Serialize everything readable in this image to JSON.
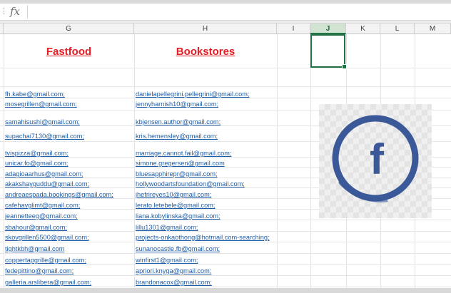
{
  "formula_bar": {
    "fx_label": "fx",
    "value": ""
  },
  "columns": [
    "G",
    "H",
    "I",
    "J",
    "K",
    "L",
    "M"
  ],
  "selected_column": "J",
  "headers": {
    "fastfood": "Fastfood",
    "bookstores": "Bookstores"
  },
  "fastfood_emails": [
    "fh.kabe@gmail.com;",
    "mosegrillen@gmail.com;",
    "samahisushi@gmail.com;",
    "supachai7130@gmail.com;",
    "tvispizza@gmail.com;",
    "unicar.fo@gmail.com;",
    "adagioaarhus@gmail.com;",
    "akakshayguddu@gmail.com;",
    "andreaespada.bookings@gmail.com;",
    "cafehavglimt@gmail.com;",
    "jeannetteeg@gmail.com;",
    "sbahour@gmail.com;",
    "skovgrillen5500@gmail.com;",
    "tightkbh@gmail.com",
    "coppertapgrille@gmail.com;",
    "fedepittino@gmail.com;",
    "galleria.arslibera@gmail.com;"
  ],
  "bookstore_emails": [
    "danielapellegrini.pellegrini@gmail.com;",
    "jennyharnish10@gmail.com;",
    "kbjensen.author@gmail.com;",
    "kris.hemensley@gmail.com;",
    "marriage.cannot.fail@gmail.com;",
    "simone.gregersen@gmail.com",
    "bluesapphirepr@gmail.com;",
    "hollywoodartsfoundation@gmail.com;",
    "jhefrireyes10@gmail.com;",
    "lerato.letebele@gmail.com;",
    "liana.kobylinska@gmail.com;",
    "lillu1301@gmail.com;",
    "projects-onkaothong@hotmail.com-searching;",
    "sunanocastle.fb@gmail.com;",
    "winfirst1@gmail.com;",
    "apriori.knyga@gmail.com;",
    "brandonacox@gmail.com;"
  ],
  "logo": {
    "letter": "f",
    "ring_color": "#3b5998"
  }
}
